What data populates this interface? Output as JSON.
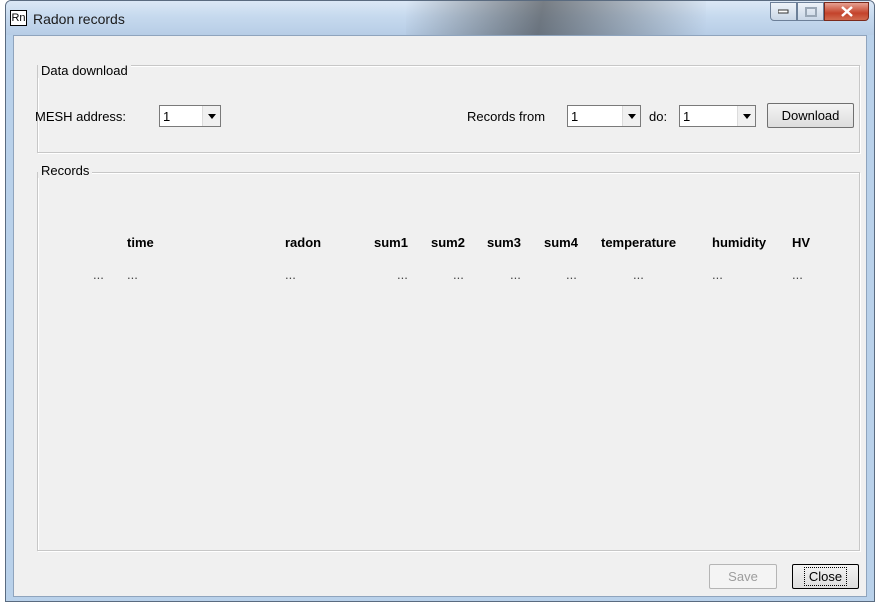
{
  "window": {
    "icon_text": "Rn",
    "title": "Radon records"
  },
  "download": {
    "group_label": "Data download",
    "mesh_label": "MESH address:",
    "mesh_value": "1",
    "records_from_label": "Records from",
    "records_from_value": "1",
    "do_label": "do:",
    "do_value": "1",
    "download_button": "Download"
  },
  "records": {
    "group_label": "Records",
    "columns": [
      "time",
      "radon",
      "sum1",
      "sum2",
      "sum3",
      "sum4",
      "temperature",
      "humidity",
      "HV"
    ],
    "row": [
      "...",
      "...",
      "...",
      "...",
      "...",
      "...",
      "...",
      "...",
      "...",
      "..."
    ]
  },
  "footer": {
    "save_button": "Save",
    "close_button": "Close"
  }
}
